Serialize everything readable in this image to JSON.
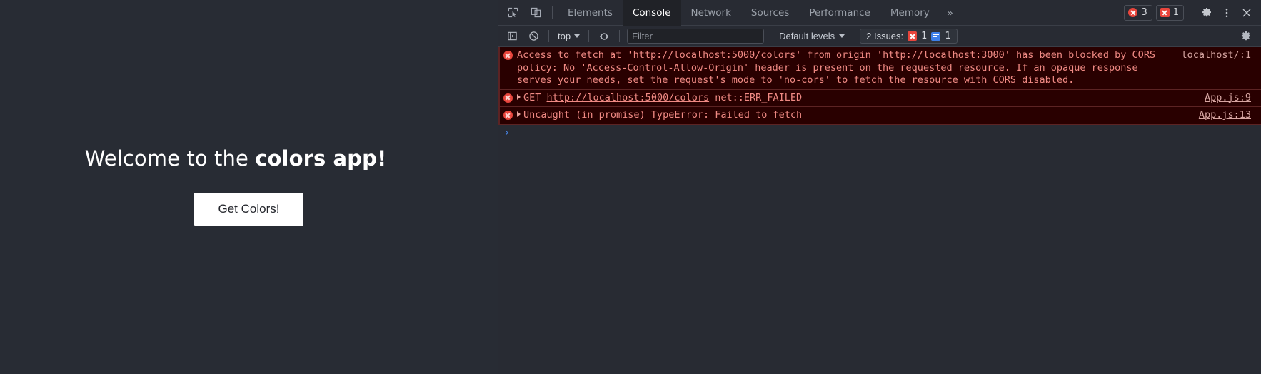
{
  "page": {
    "heading_prefix": "Welcome to the ",
    "heading_strong": "colors app!",
    "emoji_name": "rainbow-emoji",
    "button_label": "Get Colors!",
    "background_color": "#282c34"
  },
  "devtools": {
    "tabs": [
      {
        "label": "Elements",
        "active": false
      },
      {
        "label": "Console",
        "active": true
      },
      {
        "label": "Network",
        "active": false
      },
      {
        "label": "Sources",
        "active": false
      },
      {
        "label": "Performance",
        "active": false
      },
      {
        "label": "Memory",
        "active": false
      }
    ],
    "more_tabs_glyph": "»",
    "error_badge_count": "3",
    "issue_badge_count": "1",
    "icons": {
      "inspect": "inspect-element-icon",
      "device": "device-toolbar-icon",
      "settings": "gear-icon",
      "menu": "kebab-menu-icon",
      "close": "close-icon"
    },
    "console_toolbar": {
      "sidebar_toggle": "console-sidebar-icon",
      "clear_console": "clear-console-icon",
      "context_label": "top",
      "live_expression": "eye-icon",
      "filter_placeholder": "Filter",
      "filter_value": "",
      "levels_label": "Default levels",
      "issues_label": "2 Issues:",
      "issues_error_count": "1",
      "issues_info_count": "1",
      "settings": "gear-icon"
    },
    "messages": [
      {
        "level": "error",
        "expandable": false,
        "segments": [
          {
            "t": "Access to fetch at '",
            "link": false
          },
          {
            "t": "http://localhost:5000/colors",
            "link": true
          },
          {
            "t": "' from origin '",
            "link": false
          },
          {
            "t": "http://localhost:3000",
            "link": true
          },
          {
            "t": "' has been blocked by CORS policy: No 'Access-Control-Allow-Origin' header is present on the requested resource. If an opaque response serves your needs, set the request's mode to 'no-cors' to fetch the resource with CORS disabled.",
            "link": false
          }
        ],
        "source": "localhost/:1"
      },
      {
        "level": "error",
        "expandable": true,
        "segments": [
          {
            "t": "GET ",
            "link": false
          },
          {
            "t": "http://localhost:5000/colors",
            "link": true
          },
          {
            "t": " net::ERR_FAILED",
            "link": false
          }
        ],
        "source": "App.js:9"
      },
      {
        "level": "error",
        "expandable": true,
        "segments": [
          {
            "t": "Uncaught (in promise) TypeError: Failed to fetch",
            "link": false
          }
        ],
        "source": "App.js:13"
      }
    ],
    "prompt": {
      "arrow": "›",
      "value": ""
    },
    "colors": {
      "chrome_bg": "#282b33",
      "active_tab_bg": "#202227",
      "error_row_bg": "#290000",
      "error_text": "#f08a84",
      "error_red": "#e8453c",
      "info_blue": "#3d7fe8",
      "prompt_blue": "#4a8df8"
    }
  }
}
